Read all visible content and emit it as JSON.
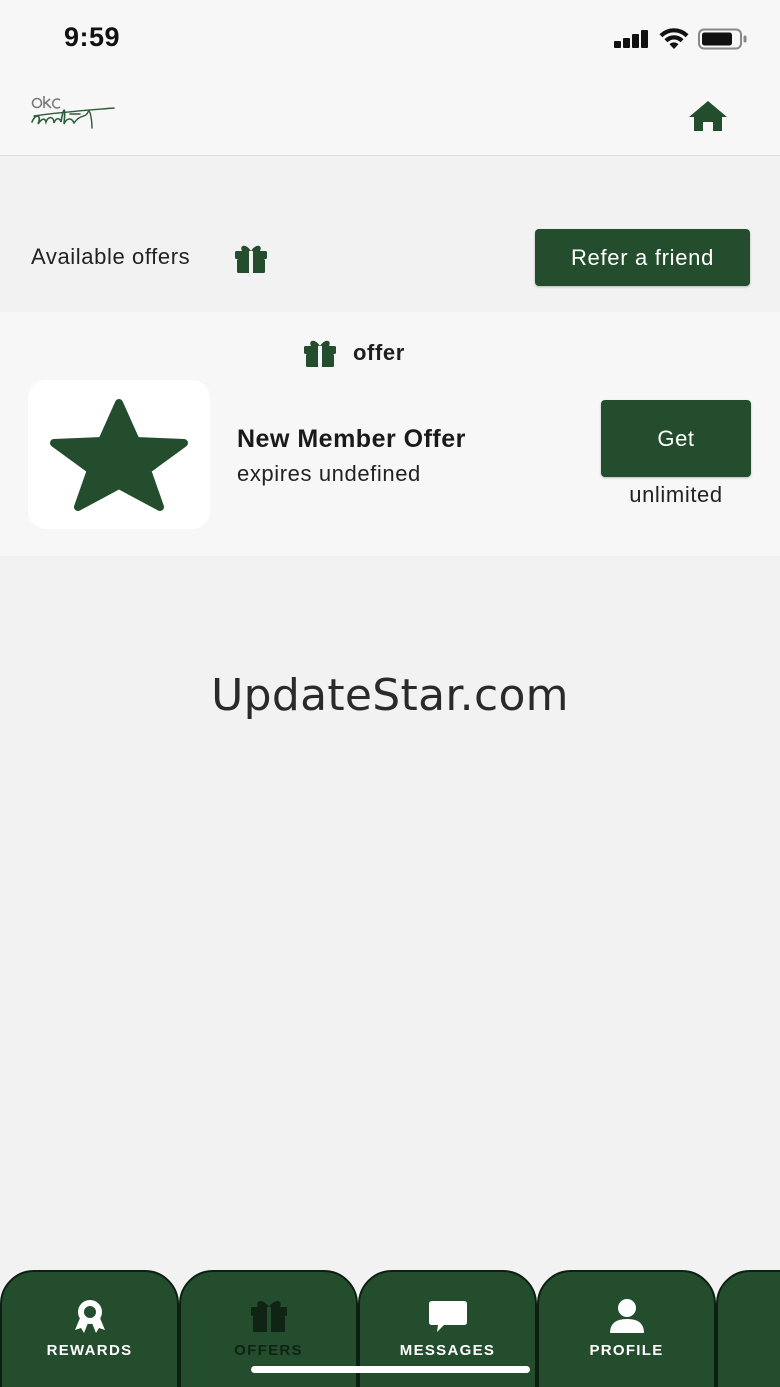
{
  "status_bar": {
    "time": "9:59"
  },
  "header": {
    "logo_text_top": "okc",
    "logo_text_bottom": "craft",
    "home_icon": "home-icon"
  },
  "offers_header": {
    "label": "Available offers",
    "icon": "gift-icon",
    "refer_button": "Refer a friend"
  },
  "offer_section": {
    "title": "offer",
    "icon": "gift-icon",
    "offer": {
      "image_icon": "star-icon",
      "title": "New Member Offer",
      "expiry": "expires undefined",
      "action": "Get",
      "limit": "unlimited"
    }
  },
  "watermark": "UpdateStar.com",
  "tabs": [
    {
      "label": "REWARDS",
      "icon": "rewards-icon",
      "active": false
    },
    {
      "label": "OFFERS",
      "icon": "gift-icon",
      "active": true
    },
    {
      "label": "MESSAGES",
      "icon": "message-icon",
      "active": false
    },
    {
      "label": "PROFILE",
      "icon": "profile-icon",
      "active": false
    }
  ],
  "colors": {
    "brand_green": "#234d2d",
    "background": "#f2f2f2",
    "card": "#f7f7f7"
  }
}
